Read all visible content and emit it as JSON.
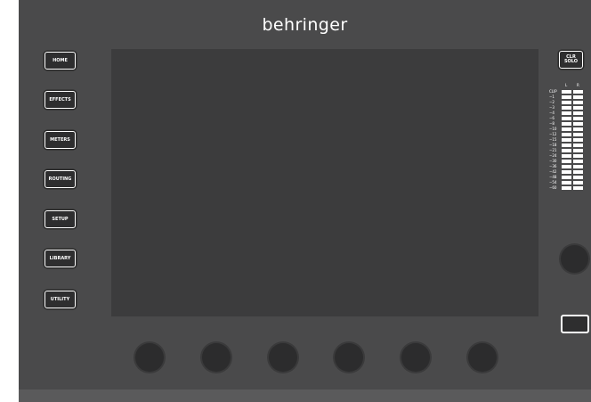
{
  "brand": {
    "logo_text": "behringer"
  },
  "sidebar": {
    "buttons": [
      {
        "label": "HOME"
      },
      {
        "label": "EFFECTS"
      },
      {
        "label": "METERS"
      },
      {
        "label": "ROUTING"
      },
      {
        "label": "SETUP"
      },
      {
        "label": "LIBRARY"
      },
      {
        "label": "UTILITY"
      }
    ]
  },
  "clr_solo": {
    "line1": "CLR",
    "line2": "SOLO"
  },
  "meter": {
    "channel_left": "L",
    "channel_right": "R",
    "scale": [
      "CLIP",
      "−1",
      "−2",
      "−3",
      "−4",
      "−6",
      "−8",
      "−10",
      "−12",
      "−15",
      "−18",
      "−21",
      "−24",
      "−30",
      "−36",
      "−42",
      "−48",
      "−54",
      "−60"
    ]
  },
  "colors": {
    "panel": "#4a4a4b",
    "screen": "#3c3c3d",
    "knob": "#2c2c2d",
    "label": "#ffffff"
  }
}
